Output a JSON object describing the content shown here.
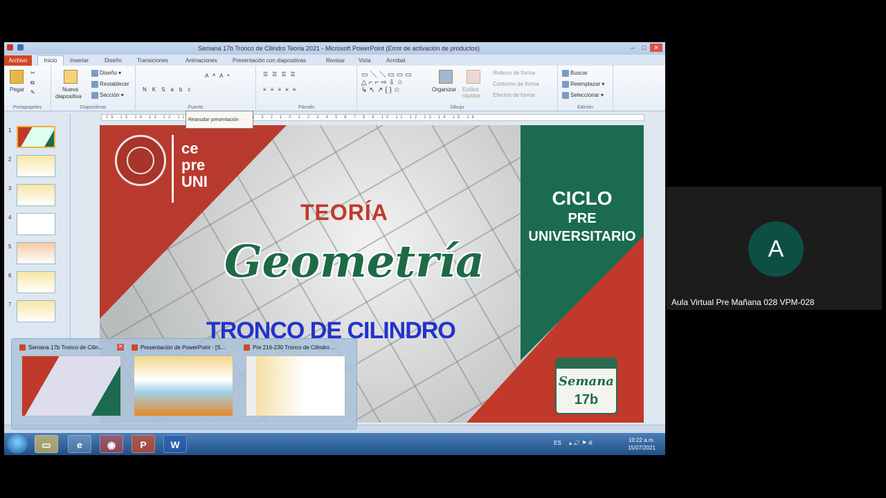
{
  "window": {
    "title": "Semana 17b Tronco de Cilindro Teoria 2021 - Microsoft PowerPoint (Error de activación de productos)"
  },
  "ribbon_tabs": [
    "Archivo",
    "Inicio",
    "Insertar",
    "Diseño",
    "Transiciones",
    "Animaciones",
    "Presentación con diapositivas",
    "Revisar",
    "Vista",
    "Acrobat"
  ],
  "ribbon": {
    "pegar": "Pegar",
    "nueva": "Nueva",
    "diapositiva": "diapositiva",
    "diseno": "Diseño",
    "restablecer": "Restablecer",
    "seccion": "Sección",
    "organizar": "Organizar",
    "estilos_rapidos": "Estilos rápidos",
    "relleno": "Relleno de forma",
    "contorno": "Contorno de forma",
    "efectos": "Efectos de forma",
    "buscar": "Buscar",
    "reemplazar": "Reemplazar",
    "seleccionar": "Seleccionar",
    "groups": [
      "Portapapeles",
      "Diapositivas",
      "Fuente",
      "Párrafo",
      "Dibujo",
      "Edición"
    ]
  },
  "tooltip": "Reanudar presentación",
  "slide_numbers": [
    "1",
    "2",
    "3",
    "4",
    "5",
    "6",
    "7"
  ],
  "slide": {
    "logo_line1": "ce",
    "logo_line2": "pre",
    "logo_line3": "UNI",
    "teoria": "TEORÍA",
    "geometria": "Geometría",
    "tronco": "TRONCO DE CILINDRO",
    "ciclo": "CICLO",
    "pre": "PRE",
    "universitario": "UNIVERSITARIO",
    "semana": "Semana",
    "semana_num": "17b"
  },
  "previews": [
    {
      "title": "Semana 17b Tronco de Cilin..."
    },
    {
      "title": "Presentación de PowerPoint - [S..."
    },
    {
      "title": "Pre 216-230 Tronco de Cilindro ..."
    }
  ],
  "taskbar": {
    "lang": "ES",
    "time": "10:22 a.m.",
    "date": "15/07/2021"
  },
  "participant": {
    "initial": "A",
    "name": "Aula Virtual Pre Mañana 028 VPM-028"
  },
  "colors": {
    "red": "#c0392b",
    "green": "#1a6b4f",
    "avatar": "#0e4f45"
  }
}
